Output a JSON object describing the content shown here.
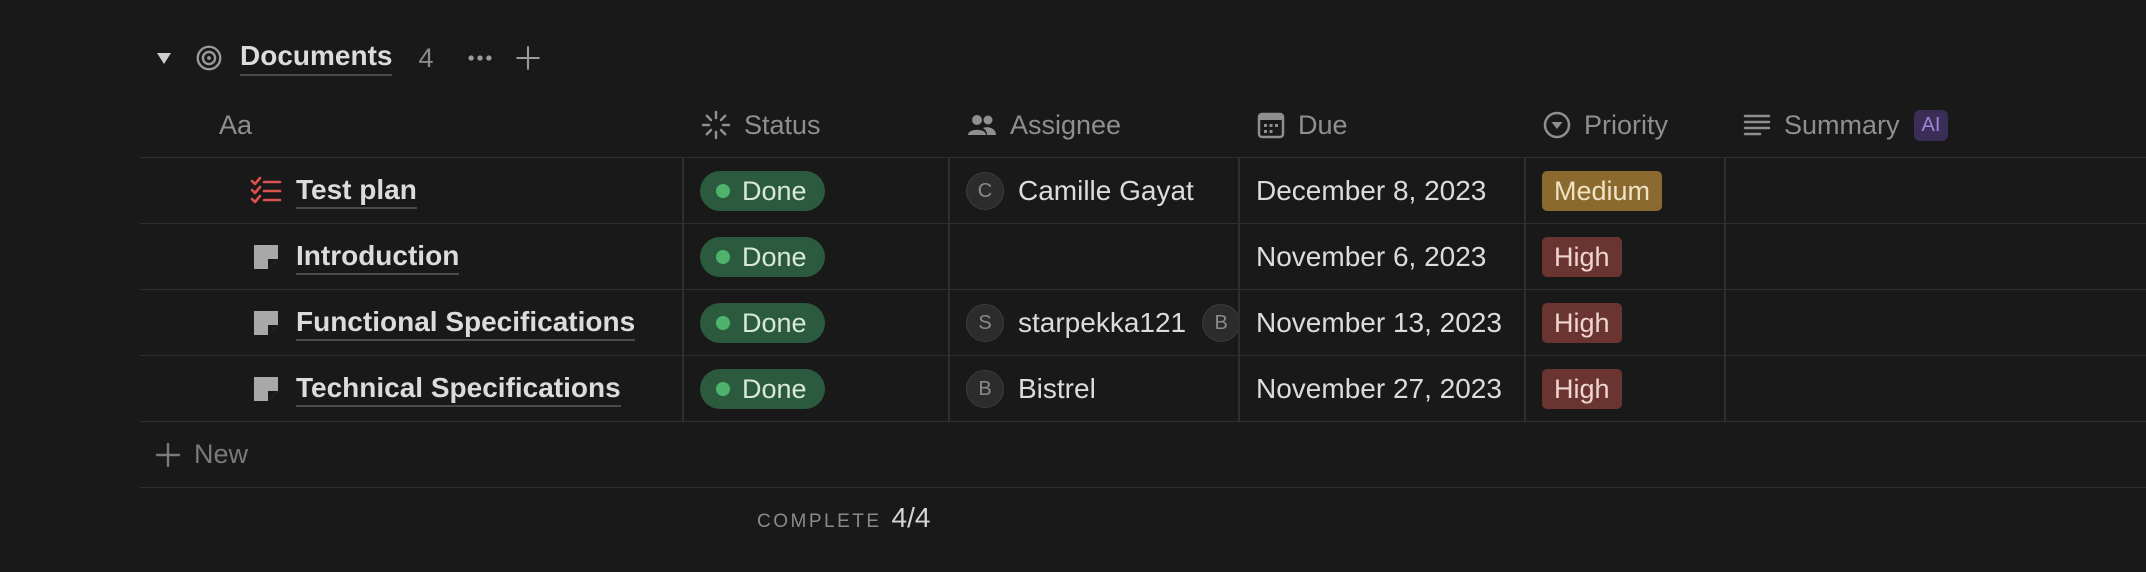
{
  "group": {
    "title": "Documents",
    "count": "4"
  },
  "columns": {
    "name": "Aa",
    "status": "Status",
    "assignee": "Assignee",
    "due": "Due",
    "priority": "Priority",
    "summary": "Summary",
    "summary_badge": "AI"
  },
  "rows": [
    {
      "name": "Test plan",
      "icon": "checklist-icon",
      "status": "Done",
      "assignee_initial": "C",
      "assignee": "Camille Gayat",
      "extra_assignee_initial": "",
      "due": "December 8, 2023",
      "priority": "Medium"
    },
    {
      "name": "Introduction",
      "icon": "document-icon",
      "status": "Done",
      "assignee_initial": "",
      "assignee": "",
      "extra_assignee_initial": "",
      "due": "November 6, 2023",
      "priority": "High"
    },
    {
      "name": "Functional Specifications",
      "icon": "document-icon",
      "status": "Done",
      "assignee_initial": "S",
      "assignee": "starpekka121",
      "extra_assignee_initial": "B",
      "due": "November 13, 2023",
      "priority": "High"
    },
    {
      "name": "Technical Specifications",
      "icon": "document-icon",
      "status": "Done",
      "assignee_initial": "B",
      "assignee": "Bistrel",
      "extra_assignee_initial": "",
      "due": "November 27, 2023",
      "priority": "High"
    }
  ],
  "new_label": "New",
  "footer": {
    "label": "COMPLETE",
    "value": "4/4"
  },
  "colors": {
    "background": "#191919",
    "status_done": "#2b5a3e",
    "priority_medium": "#8b6a2f",
    "priority_high": "#6a3530",
    "checklist_icon": "#d9534f"
  }
}
